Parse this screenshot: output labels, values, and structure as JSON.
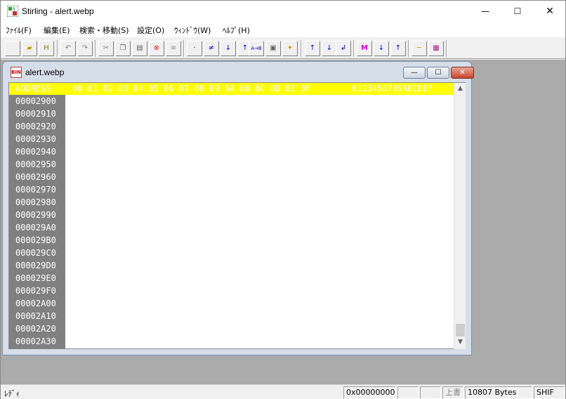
{
  "app": {
    "title": "Stirling - alert.webp"
  },
  "window_controls": {
    "minimize": "—",
    "maximize": "☐",
    "close": "✕"
  },
  "menu": [
    {
      "label": "ﾌｧｲﾙ(F)"
    },
    {
      "label": "編集(E)"
    },
    {
      "label": "検索・移動(S)"
    },
    {
      "label": "設定(O)"
    },
    {
      "label": "ｳｨﾝﾄﾞｳ(W)"
    },
    {
      "label": "ﾍﾙﾌﾟ(H)"
    }
  ],
  "toolbar": {
    "buttons": [
      {
        "icon": "new-file-icon",
        "glyph": ""
      },
      {
        "icon": "open-folder-icon",
        "glyph": "▰"
      },
      {
        "icon": "h-icon",
        "glyph": "H"
      },
      {
        "icon": "undo-icon",
        "glyph": "↶"
      },
      {
        "icon": "redo-icon",
        "glyph": "↷"
      },
      {
        "icon": "cut-icon",
        "glyph": "✂"
      },
      {
        "icon": "copy-icon",
        "glyph": "❐"
      },
      {
        "icon": "paste-icon",
        "glyph": "▤"
      },
      {
        "icon": "delete-icon",
        "glyph": "⊗"
      },
      {
        "icon": "list-icon",
        "glyph": "≡"
      },
      {
        "icon": "goto-icon",
        "glyph": "·"
      },
      {
        "icon": "not-equal-icon",
        "glyph": "≠"
      },
      {
        "icon": "search-down-icon",
        "glyph": "↓"
      },
      {
        "icon": "search-up-icon",
        "glyph": "↑"
      },
      {
        "icon": "replace-icon",
        "glyph": "A→B"
      },
      {
        "icon": "compare-icon",
        "glyph": "▣"
      },
      {
        "icon": "highlight-icon",
        "glyph": "✦"
      },
      {
        "icon": "jump-top-icon",
        "glyph": "↑"
      },
      {
        "icon": "jump-bottom-icon",
        "glyph": "↓"
      },
      {
        "icon": "return-icon",
        "glyph": "↲"
      },
      {
        "icon": "mark-icon",
        "glyph": "M"
      },
      {
        "icon": "mark-next-icon",
        "glyph": "↓"
      },
      {
        "icon": "mark-prev-icon",
        "glyph": "↑"
      },
      {
        "icon": "note-icon",
        "glyph": "─"
      },
      {
        "icon": "book-icon",
        "glyph": "▦"
      }
    ]
  },
  "child_window": {
    "title": "alert.webp",
    "icon_label": "BIN",
    "header": {
      "address": "ADDRESS",
      "columns": "00 01 02 03 04 05 06 07 08 09 0A 0B 0C 0D 0E 0F",
      "ascii": "0123456789ABCDEF"
    },
    "rows": [
      "00002900",
      "00002910",
      "00002920",
      "00002930",
      "00002940",
      "00002950",
      "00002960",
      "00002970",
      "00002980",
      "00002990",
      "000029A0",
      "000029B0",
      "000029C0",
      "000029D0",
      "000029E0",
      "000029F0",
      "00002A00",
      "00002A10",
      "00002A20",
      "00002A30"
    ],
    "scroll": {
      "up": "▲",
      "down": "▼",
      "position_fraction": 1.0
    }
  },
  "status": {
    "text": "ﾚﾃﾞｨ",
    "offset": "0x00000000",
    "cell2": "",
    "cell3": "",
    "mode": "上書",
    "size": "10807 Bytes",
    "shift": "SHIF"
  },
  "colors": {
    "header_bg": "#ffff00",
    "address_bg": "#808080",
    "mdi_bg": "#ababab"
  }
}
